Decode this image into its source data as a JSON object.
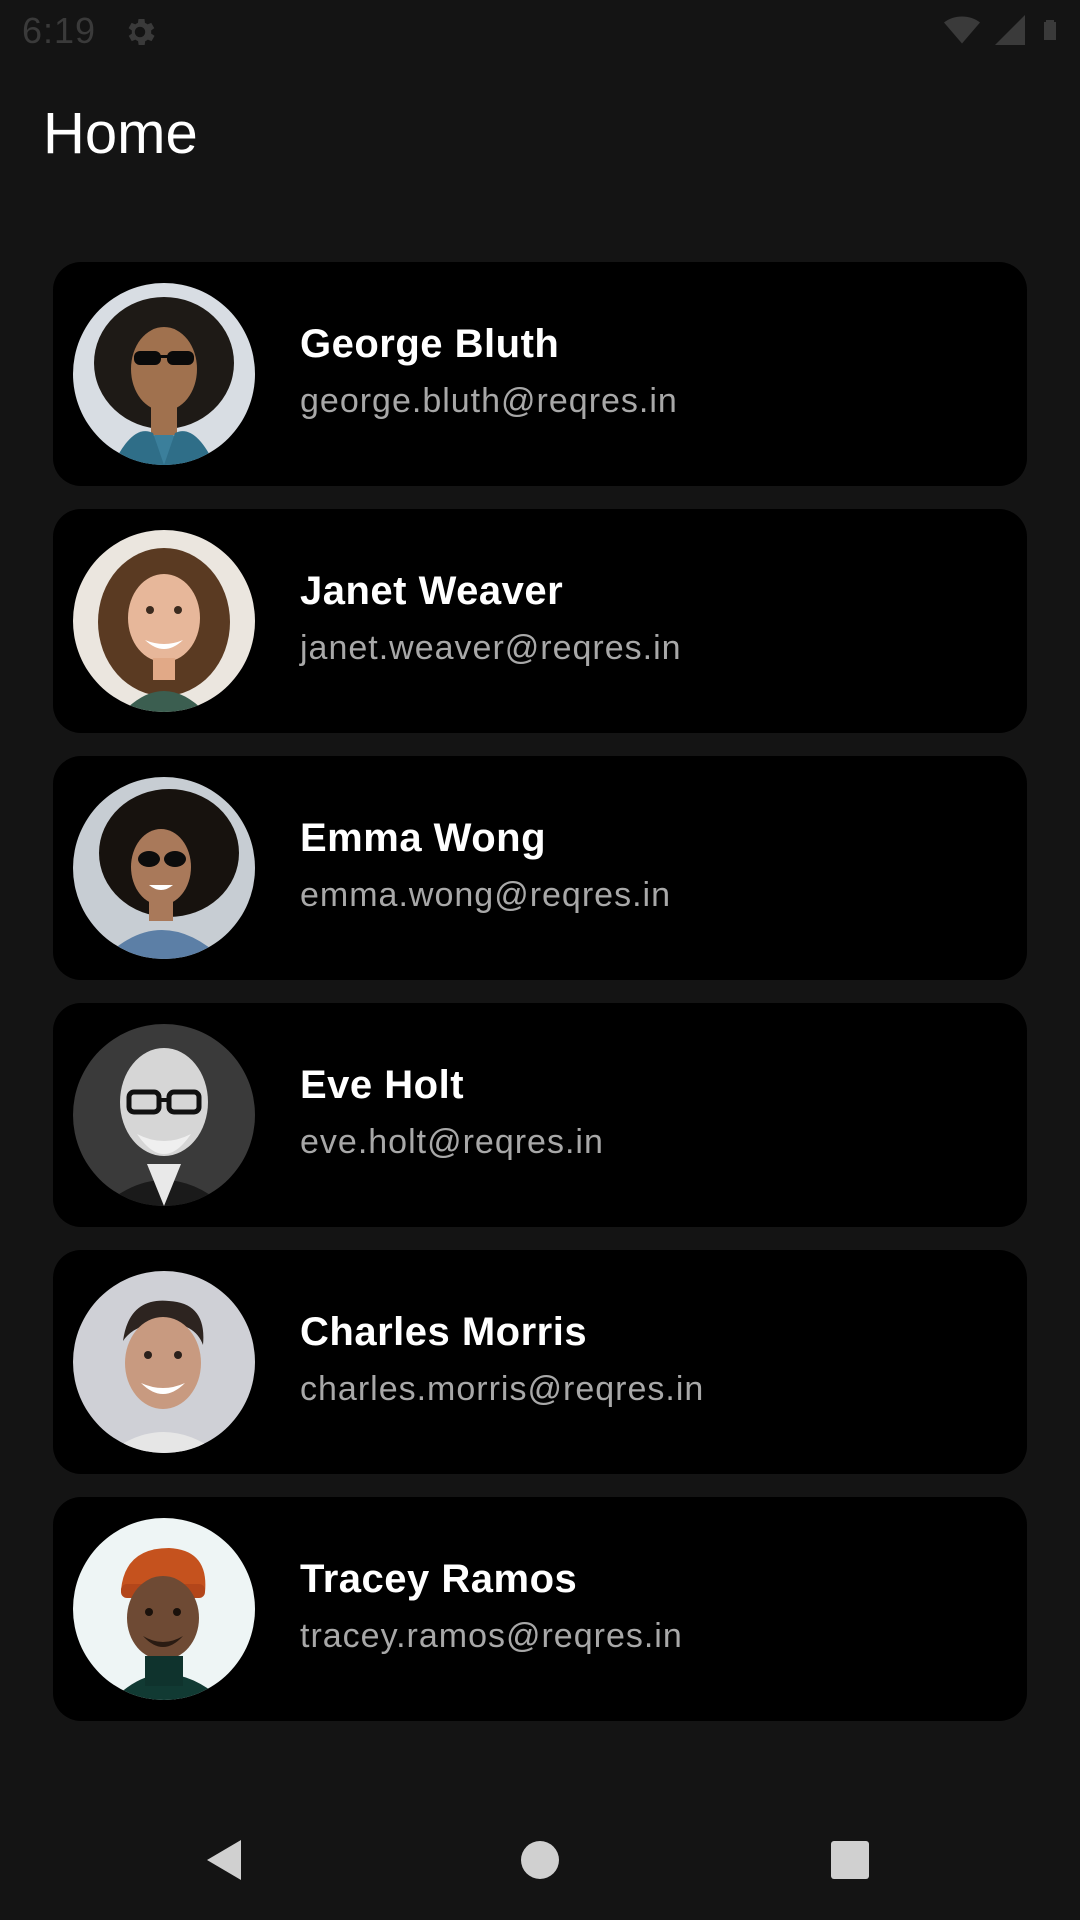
{
  "status_bar": {
    "time": "6:19",
    "icons": [
      "settings-icon",
      "wifi-icon",
      "signal-icon",
      "battery-icon"
    ]
  },
  "header": {
    "title": "Home"
  },
  "users": [
    {
      "name": "George Bluth",
      "email": "george.bluth@reqres.in",
      "avatar": "portrait-man-sunglasses-curly-hair"
    },
    {
      "name": "Janet Weaver",
      "email": "janet.weaver@reqres.in",
      "avatar": "portrait-woman-smiling-wavy-hair"
    },
    {
      "name": "Emma Wong",
      "email": "emma.wong@reqres.in",
      "avatar": "portrait-woman-sunglasses-curly-hair"
    },
    {
      "name": "Eve Holt",
      "email": "eve.holt@reqres.in",
      "avatar": "portrait-man-glasses-bald"
    },
    {
      "name": "Charles Morris",
      "email": "charles.morris@reqres.in",
      "avatar": "portrait-man-smiling"
    },
    {
      "name": "Tracey Ramos",
      "email": "tracey.ramos@reqres.in",
      "avatar": "portrait-man-orange-beanie"
    }
  ],
  "nav_bar": {
    "buttons": [
      "back-icon",
      "home-icon",
      "recents-icon"
    ]
  },
  "colors": {
    "background": "#141414",
    "card": "#000000",
    "name_text": "#ffffff",
    "email_text": "#a8a8a8"
  }
}
